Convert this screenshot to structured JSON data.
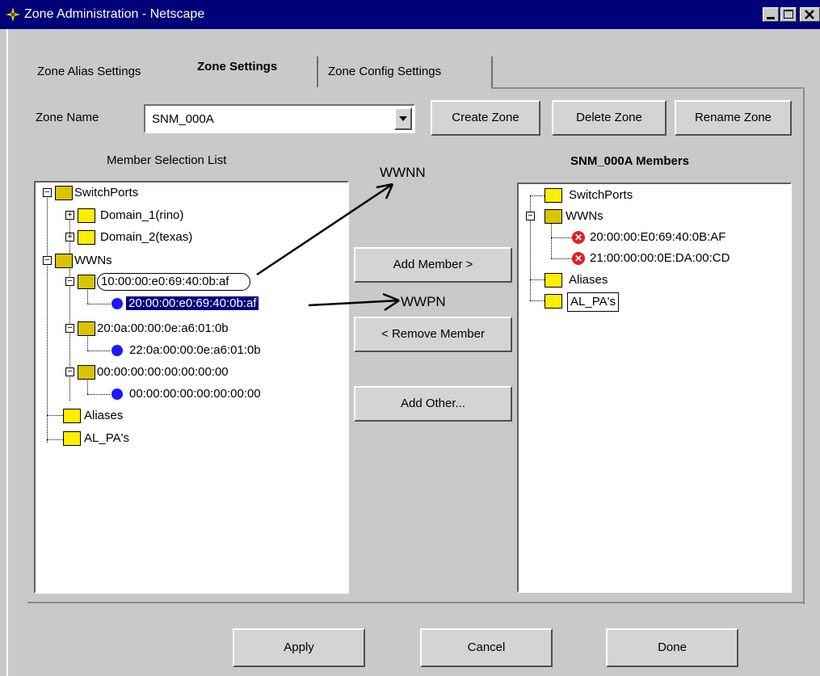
{
  "window": {
    "title": "Zone Administration - Netscape"
  },
  "tabs": [
    {
      "label": "Zone Alias Settings"
    },
    {
      "label": "Zone Settings"
    },
    {
      "label": "Zone Config Settings"
    }
  ],
  "zone_name": {
    "label": "Zone Name",
    "value": "SNM_000A"
  },
  "zone_buttons": {
    "create": "Create Zone",
    "delete": "Delete Zone",
    "rename": "Rename Zone"
  },
  "member_list": {
    "heading": "Member Selection List",
    "nodes": [
      "SwitchPorts",
      "Domain_1(rino)",
      "Domain_2(texas)",
      "WWNs",
      "10:00:00:e0:69:40:0b:af",
      "20:00:00:e0:69:40:0b:af",
      "20:0a:00:00:0e:a6:01:0b",
      "22:0a:00:00:0e:a6:01:0b",
      "00:00:00:00:00:00:00:00",
      "00:00:00:00:00:00:00:00",
      "Aliases",
      "AL_PA's"
    ]
  },
  "middle_buttons": {
    "add_member": "Add Member >",
    "remove_member": "< Remove Member",
    "add_other": "Add Other..."
  },
  "annotations": {
    "wwnn": "WWNN",
    "wwpn": "WWPN"
  },
  "zone_members": {
    "heading": "SNM_000A Members",
    "nodes": [
      "SwitchPorts",
      "WWNs",
      "20:00:00:E0:69:40:0B:AF",
      "21:00:00:00:0E:DA:00:CD",
      "Aliases",
      "AL_PA's"
    ]
  },
  "footer": {
    "apply": "Apply",
    "cancel": "Cancel",
    "done": "Done"
  },
  "icons": {
    "app": "netscape-icon",
    "minimize": "minimize-icon",
    "maximize": "maximize-icon",
    "close": "close-icon"
  }
}
